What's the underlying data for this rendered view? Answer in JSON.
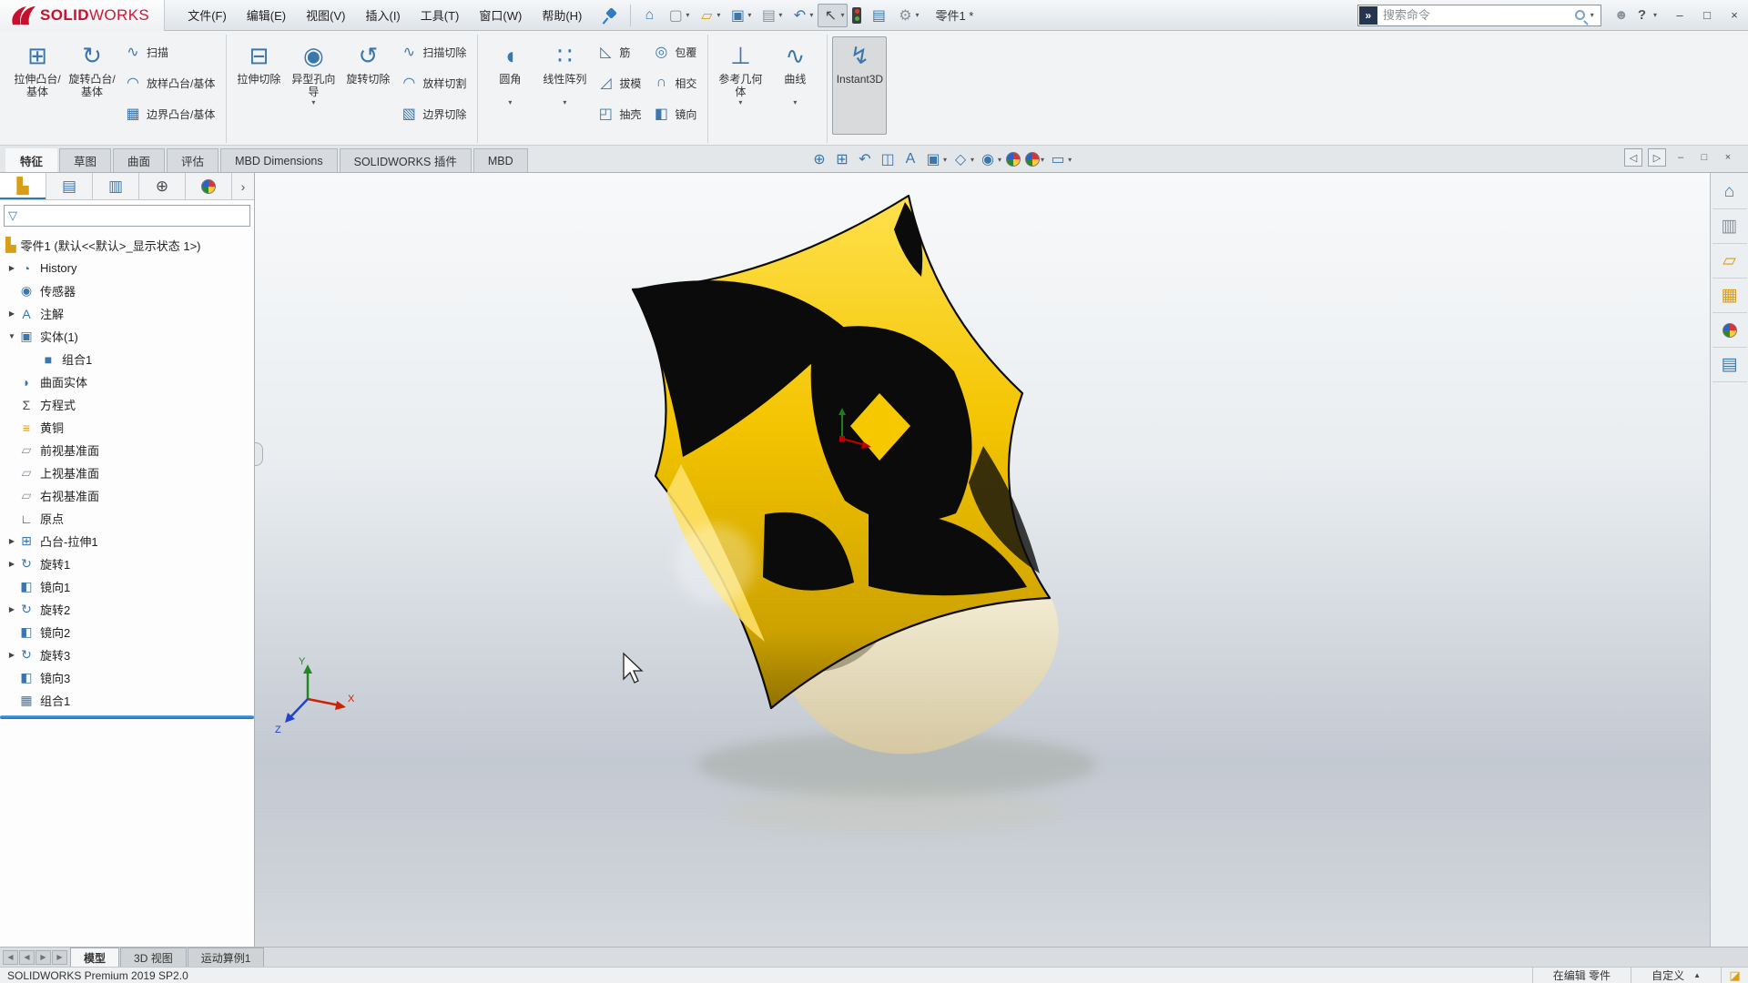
{
  "colors": {
    "accent_blue": "#2e7bb8",
    "logo_red": "#c8102e",
    "model_yellow": "#f2c500",
    "rollback_blue": "#1472c8"
  },
  "icons": {
    "caret_down": "▾",
    "caret_up": "▲",
    "chevron_right": "›"
  },
  "titlebar": {
    "logo_solid": "SOLID",
    "logo_works": "WORKS",
    "menus": [
      {
        "name": "menu-file",
        "label": "文件(F)"
      },
      {
        "name": "menu-edit",
        "label": "编辑(E)"
      },
      {
        "name": "menu-view",
        "label": "视图(V)"
      },
      {
        "name": "menu-insert",
        "label": "插入(I)"
      },
      {
        "name": "menu-tools",
        "label": "工具(T)"
      },
      {
        "name": "menu-window",
        "label": "窗口(W)"
      },
      {
        "name": "menu-help",
        "label": "帮助(H)"
      }
    ],
    "quick_tools": [
      {
        "name": "home-button",
        "glyph": "⌂",
        "cls": "c-blue"
      },
      {
        "name": "new-document-button",
        "glyph": "▢",
        "cls": "c-gray",
        "caret": true
      },
      {
        "name": "open-button",
        "glyph": "▱",
        "cls": "c-amber",
        "caret": true
      },
      {
        "name": "save-button",
        "glyph": "▣",
        "cls": "c-blue",
        "caret": true
      },
      {
        "name": "print-button",
        "glyph": "▤",
        "cls": "c-gray",
        "caret": true
      },
      {
        "name": "undo-button",
        "glyph": "↶",
        "cls": "c-blue",
        "caret": true
      },
      {
        "name": "select-button",
        "glyph": "↖",
        "cls": "c-dark",
        "caret": true,
        "active": true
      },
      {
        "name": "traffic-light-button",
        "glyph": "",
        "cls": "traffic"
      },
      {
        "name": "display-settings-button",
        "glyph": "▤",
        "cls": "c-blue"
      },
      {
        "name": "options-button",
        "glyph": "⚙",
        "cls": "c-gray",
        "caret": true
      }
    ],
    "document_name": "零件1 *",
    "search_logo_glyph": "»",
    "search_placeholder": "搜索命令",
    "user_glyph": "☻",
    "help_label": "?",
    "window_buttons": [
      {
        "name": "minimize-button",
        "glyph": "–"
      },
      {
        "name": "restore-button",
        "glyph": "□"
      },
      {
        "name": "close-button",
        "glyph": "×"
      }
    ]
  },
  "ribbon": {
    "groups": [
      {
        "big": [
          {
            "name": "extruded-boss-base-button",
            "label": "拉伸凸台/基体",
            "glyph": "⊞"
          },
          {
            "name": "revolved-boss-base-button",
            "label": "旋转凸台/基体",
            "glyph": "↻"
          }
        ],
        "small": [
          {
            "name": "swept-boss-base-button",
            "label": "扫描",
            "glyph": "∿"
          },
          {
            "name": "lofted-boss-base-button",
            "label": "放样凸台/基体",
            "glyph": "◠"
          },
          {
            "name": "boundary-boss-base-button",
            "label": "边界凸台/基体",
            "glyph": "▦"
          }
        ]
      },
      {
        "big": [
          {
            "name": "extruded-cut-button",
            "label": "拉伸切除",
            "glyph": "⊟"
          },
          {
            "name": "hole-wizard-button",
            "label": "异型孔向导",
            "glyph": "◉",
            "caret": true
          },
          {
            "name": "revolved-cut-button",
            "label": "旋转切除",
            "glyph": "↺"
          }
        ],
        "small": [
          {
            "name": "swept-cut-button",
            "label": "扫描切除",
            "glyph": "∿"
          },
          {
            "name": "lofted-cut-button",
            "label": "放样切割",
            "glyph": "◠"
          },
          {
            "name": "boundary-cut-button",
            "label": "边界切除",
            "glyph": "▧"
          }
        ]
      },
      {
        "big": [
          {
            "name": "fillet-button",
            "label": "圆角",
            "glyph": "◖",
            "caret": true
          },
          {
            "name": "linear-pattern-button",
            "label": "线性阵列",
            "glyph": "∷",
            "caret": true
          }
        ],
        "small": [
          {
            "name": "rib-button",
            "label": "筋",
            "glyph": "◺"
          },
          {
            "name": "draft-button",
            "label": "拔模",
            "glyph": "◿"
          },
          {
            "name": "shell-button",
            "label": "抽壳",
            "glyph": "◰"
          }
        ],
        "small2": [
          {
            "name": "wrap-button",
            "label": "包覆",
            "glyph": "◎"
          },
          {
            "name": "intersect-button",
            "label": "相交",
            "glyph": "∩"
          },
          {
            "name": "mirror-button",
            "label": "镜向",
            "glyph": "◧"
          }
        ]
      },
      {
        "big": [
          {
            "name": "reference-geometry-button",
            "label": "参考几何体",
            "glyph": "⊥",
            "caret": true
          },
          {
            "name": "curves-button",
            "label": "曲线",
            "glyph": "∿",
            "caret": true
          }
        ]
      },
      {
        "big": [
          {
            "name": "instant3d-button",
            "label": "Instant3D",
            "glyph": "↯",
            "active": true
          }
        ]
      }
    ]
  },
  "command_tabs": [
    {
      "name": "tab-features",
      "label": "特征",
      "active": true
    },
    {
      "name": "tab-sketch",
      "label": "草图"
    },
    {
      "name": "tab-surfaces",
      "label": "曲面"
    },
    {
      "name": "tab-evaluate",
      "label": "评估"
    },
    {
      "name": "tab-mbd-dimensions",
      "label": "MBD Dimensions"
    },
    {
      "name": "tab-solidworks-addins",
      "label": "SOLIDWORKS 插件"
    },
    {
      "name": "tab-mbd",
      "label": "MBD"
    }
  ],
  "headsup_tools": [
    {
      "name": "zoom-to-fit-button",
      "glyph": "⊕"
    },
    {
      "name": "zoom-to-area-button",
      "glyph": "⊞"
    },
    {
      "name": "previous-view-button",
      "glyph": "↶"
    },
    {
      "name": "section-view-button",
      "glyph": "◫"
    },
    {
      "name": "annotation-views-button",
      "glyph": "A"
    },
    {
      "name": "view-orientation-button",
      "glyph": "▣",
      "caret": true
    },
    {
      "name": "display-style-button",
      "glyph": "◇",
      "caret": true
    },
    {
      "name": "hide-show-items-button",
      "glyph": "◉",
      "caret": true
    },
    {
      "name": "edit-appearance-button",
      "glyph": "",
      "cls": "ball"
    },
    {
      "name": "apply-scene-button",
      "glyph": "",
      "cls": "ball",
      "caret": true
    },
    {
      "name": "view-settings-button",
      "glyph": "▭",
      "caret": true
    }
  ],
  "viewport_controls": [
    {
      "name": "collapse-panel-left-button",
      "glyph": "◁",
      "boxed": true
    },
    {
      "name": "collapse-panel-right-button",
      "glyph": "▷",
      "boxed": true
    },
    {
      "name": "doc-minimize-button",
      "glyph": "–"
    },
    {
      "name": "doc-restore-button",
      "glyph": "□"
    },
    {
      "name": "doc-close-button",
      "glyph": "×"
    }
  ],
  "feature_tree": {
    "panel_tabs": [
      {
        "name": "featuremanager-tab",
        "glyph": "▙",
        "cls": "c-amber",
        "active": true
      },
      {
        "name": "propertymanager-tab",
        "glyph": "▤",
        "cls": "c-blue"
      },
      {
        "name": "configurationmanager-tab",
        "glyph": "▥",
        "cls": "c-blue"
      },
      {
        "name": "dimxpertmanager-tab",
        "glyph": "⊕",
        "cls": "c-dark"
      },
      {
        "name": "displaymanager-tab",
        "glyph": "",
        "cls": "ball"
      }
    ],
    "root_label": "零件1 (默认<<默认>_显示状态 1>)",
    "items": [
      {
        "name": "history-item",
        "label": "History",
        "glyph": "◔",
        "cls": "c-blue",
        "arrow": "▶"
      },
      {
        "name": "sensors-item",
        "label": "传感器",
        "glyph": "◉",
        "cls": "c-blue",
        "arrow": ""
      },
      {
        "name": "annotations-item",
        "label": "注解",
        "glyph": "A",
        "cls": "c-blue",
        "arrow": "▶"
      },
      {
        "name": "solid-bodies-item",
        "label": "实体(1)",
        "glyph": "▣",
        "cls": "c-blue",
        "arrow": "▼"
      },
      {
        "name": "combine1-body-item",
        "label": "组合1",
        "glyph": "■",
        "cls": "c-blue",
        "arrow": "",
        "indent": 1
      },
      {
        "name": "surface-bodies-item",
        "label": "曲面实体",
        "glyph": "◗",
        "cls": "c-blue",
        "arrow": ""
      },
      {
        "name": "equations-item",
        "label": "方程式",
        "glyph": "Σ",
        "cls": "c-dark",
        "arrow": ""
      },
      {
        "name": "material-brass-item",
        "label": "黄铜",
        "glyph": "≡",
        "cls": "c-amber",
        "arrow": ""
      },
      {
        "name": "front-plane-item",
        "label": "前视基准面",
        "glyph": "▱",
        "cls": "c-gray",
        "arrow": ""
      },
      {
        "name": "top-plane-item",
        "label": "上视基准面",
        "glyph": "▱",
        "cls": "c-gray",
        "arrow": ""
      },
      {
        "name": "right-plane-item",
        "label": "右视基准面",
        "glyph": "▱",
        "cls": "c-gray",
        "arrow": ""
      },
      {
        "name": "origin-item",
        "label": "原点",
        "glyph": "∟",
        "cls": "c-dark",
        "arrow": ""
      },
      {
        "name": "boss-extrude1-item",
        "label": "凸台-拉伸1",
        "glyph": "⊞",
        "cls": "c-blue",
        "arrow": "▶"
      },
      {
        "name": "revolve1-item",
        "label": "旋转1",
        "glyph": "↻",
        "cls": "c-blue",
        "arrow": "▶"
      },
      {
        "name": "mirror1-item",
        "label": "镜向1",
        "glyph": "◧",
        "cls": "c-blue",
        "arrow": ""
      },
      {
        "name": "revolve2-item",
        "label": "旋转2",
        "glyph": "↻",
        "cls": "c-blue",
        "arrow": "▶"
      },
      {
        "name": "mirror2-item",
        "label": "镜向2",
        "glyph": "◧",
        "cls": "c-blue",
        "arrow": ""
      },
      {
        "name": "revolve3-item",
        "label": "旋转3",
        "glyph": "↻",
        "cls": "c-blue",
        "arrow": "▶"
      },
      {
        "name": "mirror3-item",
        "label": "镜向3",
        "glyph": "◧",
        "cls": "c-blue",
        "arrow": ""
      },
      {
        "name": "combine1-item",
        "label": "组合1",
        "glyph": "▦",
        "cls": "c-blue",
        "arrow": ""
      }
    ]
  },
  "viewport": {
    "triad": {
      "x": "X",
      "y": "Y",
      "z": "Z"
    }
  },
  "task_pane": [
    {
      "name": "home-tab",
      "glyph": "⌂",
      "cls": "c-blue"
    },
    {
      "name": "design-library-tab",
      "glyph": "▥",
      "cls": "c-gray"
    },
    {
      "name": "file-explorer-tab",
      "glyph": "▱",
      "cls": "c-amber"
    },
    {
      "name": "view-palette-tab",
      "glyph": "▦",
      "cls": "c-amber"
    },
    {
      "name": "appearances-tab",
      "glyph": "",
      "cls": "ball"
    },
    {
      "name": "custom-properties-tab",
      "glyph": "▤",
      "cls": "c-blue"
    }
  ],
  "bottom_bar": {
    "nav": [
      {
        "name": "scroll-first-button",
        "glyph": "◀"
      },
      {
        "name": "scroll-prev-button",
        "glyph": "◀"
      },
      {
        "name": "scroll-next-button",
        "glyph": "▶"
      },
      {
        "name": "scroll-last-button",
        "glyph": "▶"
      }
    ],
    "tabs": [
      {
        "name": "tab-model",
        "label": "模型",
        "active": true
      },
      {
        "name": "tab-3d-views",
        "label": "3D 视图"
      },
      {
        "name": "tab-motion-study-1",
        "label": "运动算例1"
      }
    ]
  },
  "status_bar": {
    "product": "SOLIDWORKS Premium 2019 SP2.0",
    "editing": "在编辑 零件",
    "units": "自定义"
  }
}
